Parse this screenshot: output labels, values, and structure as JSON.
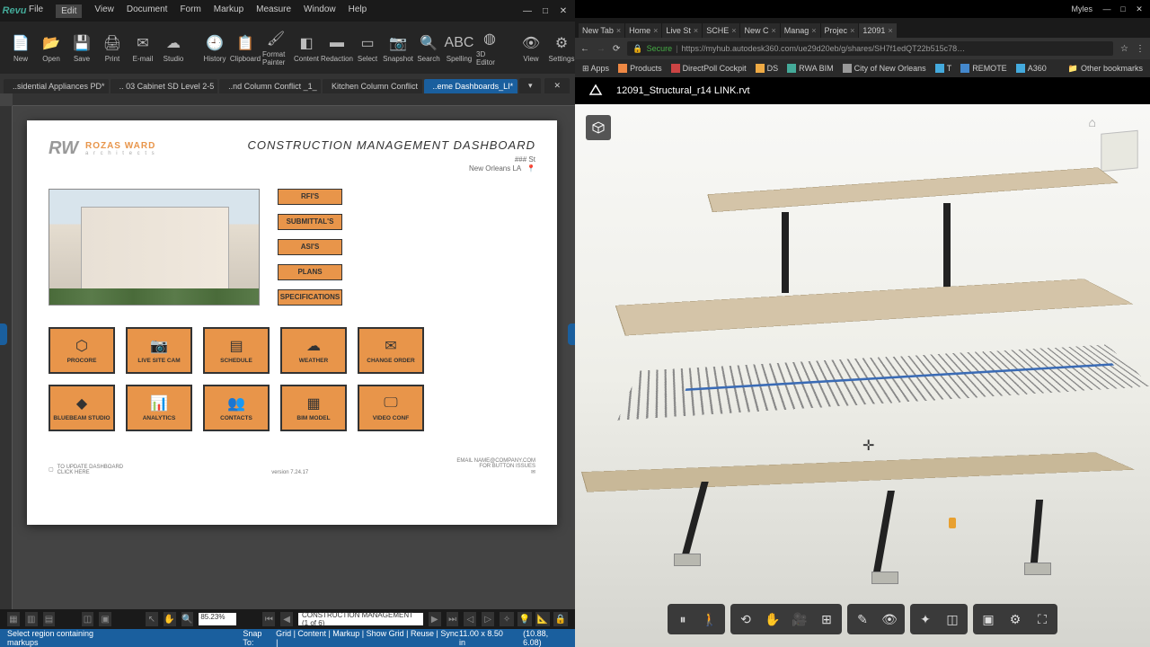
{
  "revu": {
    "logo": "Revu",
    "menus": [
      "File",
      "Edit",
      "View",
      "Document",
      "Form",
      "Markup",
      "Measure",
      "Window",
      "Help"
    ],
    "active_menu": 1,
    "toolbar": [
      {
        "label": "New",
        "glyph": "📄"
      },
      {
        "label": "Open",
        "glyph": "📂"
      },
      {
        "label": "Save",
        "glyph": "💾"
      },
      {
        "label": "Print",
        "glyph": "🖨"
      },
      {
        "label": "E-mail",
        "glyph": "✉"
      },
      {
        "label": "Studio",
        "glyph": "☁"
      },
      {
        "label": "History",
        "glyph": "🕘"
      },
      {
        "label": "Clipboard",
        "glyph": "📋"
      },
      {
        "label": "Format Painter",
        "glyph": "🖌"
      },
      {
        "label": "Content",
        "glyph": "◧"
      },
      {
        "label": "Redaction",
        "glyph": "▬"
      },
      {
        "label": "Select",
        "glyph": "▭"
      },
      {
        "label": "Snapshot",
        "glyph": "📷"
      },
      {
        "label": "Search",
        "glyph": "🔍"
      },
      {
        "label": "Spelling",
        "glyph": "ABC"
      },
      {
        "label": "3D Editor",
        "glyph": "◍"
      },
      {
        "label": "View",
        "glyph": "👁"
      },
      {
        "label": "Settings",
        "glyph": "⚙"
      }
    ],
    "tabs": [
      "..sidential Appliances PD*",
      ".. 03 Cabinet SD Level 2-5",
      "..nd Column Conflict _1_",
      "Kitchen Column Conflict",
      "..eme Dashboards_LI*"
    ],
    "active_tab": 4,
    "zoom": "85.23%",
    "page_display": "CONSTRUCTION MANAGEMENT (1 of 6)",
    "status_left": "Select region containing markups",
    "snap_label": "Snap To:",
    "snap_items": [
      "Grid",
      "Content",
      "Markup",
      "Show Grid",
      "Reuse",
      "Sync"
    ],
    "page_size": "11.00 x 8.50 in",
    "coords": "(10.88, 6.08)"
  },
  "dashboard": {
    "company": "ROZAS WARD",
    "sub": "a r c h i t e c t s",
    "title": "CONSTRUCTION MANAGEMENT DASHBOARD",
    "addr1": "### St",
    "addr2": "New Orleans LA",
    "side_buttons": [
      "RFI'S",
      "SUBMITTAL'S",
      "ASI'S",
      "PLANS",
      "SPECIFICATIONS"
    ],
    "tiles": [
      {
        "label": "PROCORE",
        "glyph": "⬡"
      },
      {
        "label": "LIVE SITE CAM",
        "glyph": "📷"
      },
      {
        "label": "SCHEDULE",
        "glyph": "▤"
      },
      {
        "label": "WEATHER",
        "glyph": "☁"
      },
      {
        "label": "CHANGE ORDER",
        "glyph": "✉"
      },
      {
        "label": "BLUEBEAM STUDIO",
        "glyph": "◆"
      },
      {
        "label": "ANALYTICS",
        "glyph": "📊"
      },
      {
        "label": "CONTACTS",
        "glyph": "👥"
      },
      {
        "label": "BIM MODEL",
        "glyph": "▦"
      },
      {
        "label": "VIDEO CONF",
        "glyph": "🖵"
      }
    ],
    "footer_left1": "TO UPDATE DASHBOARD",
    "footer_left2": "CLICK HERE",
    "version": "version 7.24.17",
    "footer_right1": "EMAIL NAME@COMPANY.COM",
    "footer_right2": "FOR BUTTON ISSUES"
  },
  "chrome": {
    "user": "Myles",
    "tabs": [
      {
        "label": "New Tab"
      },
      {
        "label": "Home"
      },
      {
        "label": "Live St"
      },
      {
        "label": "SCHE"
      },
      {
        "label": "New C"
      },
      {
        "label": "Manag"
      },
      {
        "label": "Projec"
      },
      {
        "label": "12091"
      }
    ],
    "active_tab": 7,
    "secure_label": "Secure",
    "url": "https://myhub.autodesk360.com/ue29d20eb/g/shares/SH7f1edQT22b515c78…",
    "bookmarks": [
      {
        "label": "Apps",
        "color": "#888"
      },
      {
        "label": "Products",
        "color": "#e84"
      },
      {
        "label": "DirectPoll Cockpit",
        "color": "#c44"
      },
      {
        "label": "DS",
        "color": "#ea4"
      },
      {
        "label": "RWA BIM",
        "color": "#4a9"
      },
      {
        "label": "City of New Orleans",
        "color": "#999"
      },
      {
        "label": "T",
        "color": "#4ad"
      },
      {
        "label": "REMOTE",
        "color": "#48c"
      },
      {
        "label": "A360",
        "color": "#4ad"
      }
    ],
    "other_bookmarks": "Other bookmarks",
    "viewer_title": "12091_Structural_r14 LINK.rvt"
  }
}
